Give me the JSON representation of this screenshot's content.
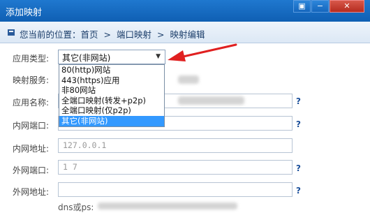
{
  "window": {
    "title": "添加映射"
  },
  "breadcrumb": {
    "items": [
      "您当前的位置：首页",
      ">",
      "端口映射",
      ">",
      "映射编辑"
    ]
  },
  "form": {
    "app_type_label": "应用类型:",
    "app_type_value": "其它(非网站)",
    "mapping_service_label": "映射服务:",
    "app_name_label": "应用名称:",
    "internal_port_label": "内网端口:",
    "internal_addr_label": "内网地址:",
    "internal_addr_value": "127.0.0.1",
    "external_port_label": "外网端口:",
    "external_port_value": "1   7",
    "external_addr_label": "外网地址:",
    "help_mark": "?",
    "bottom_partial": "dns或ps:"
  },
  "dropdown_options": [
    "80(http)网站",
    "443(https)应用",
    "非80网站",
    "全端口映射(转发+p2p)",
    "全端口映射(仅p2p)",
    "其它(非网站)"
  ],
  "selected_index": 5,
  "colors": {
    "titlebar": "#1570c8",
    "highlight": "#3399ff",
    "arrow": "#e02020"
  }
}
